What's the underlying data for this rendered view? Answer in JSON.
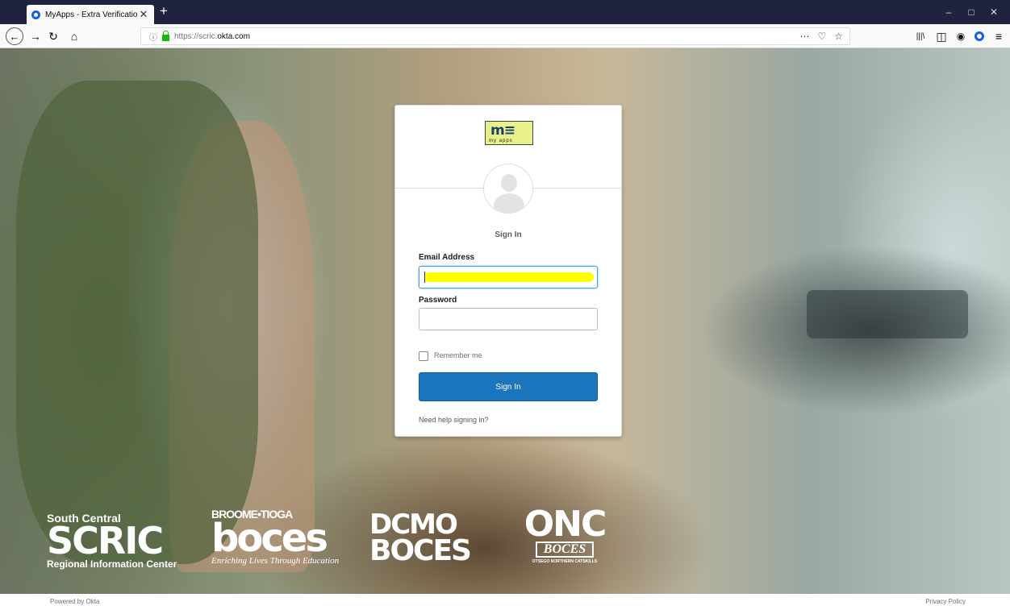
{
  "browser": {
    "tab_title": "MyApps - Extra Verification",
    "tab_close": "✕",
    "new_tab": "+",
    "url_prefix": "https://scric.",
    "url_domain": "okta.com",
    "info_icon": "ⓘ",
    "page_actions": "⋯",
    "pocket": "♡",
    "bookmark": "☆",
    "window_min": "–",
    "window_max": "□",
    "window_close": "✕",
    "library": "|||\\",
    "menu": "≡"
  },
  "login": {
    "logo_text": "m≡",
    "logo_sub": "my apps",
    "heading": "Sign In",
    "email_label": "Email Address",
    "email_value": "",
    "password_label": "Password",
    "remember_label": "Remember me",
    "remember_checked": false,
    "submit_label": "Sign In",
    "help_link": "Need help signing in?"
  },
  "logos": {
    "scric": {
      "line1": "South Central",
      "big": "SCRIC",
      "line2": "Regional Information Center"
    },
    "bt": {
      "line1": "BROOME•TIOGA",
      "big": "boces",
      "line2": "Enriching Lives Through Education"
    },
    "dcmo": {
      "line1": "DCMO",
      "line2": "BOCES"
    },
    "onc": {
      "big": "ONC",
      "boc": "BOCES",
      "line2": "OTSEGO NORTHERN CATSKILLS"
    }
  },
  "footer": {
    "powered": "Powered by Okta",
    "privacy": "Privacy Policy"
  },
  "colors": {
    "primary_button": "#1a75bc",
    "highlight": "#ffff00",
    "tabbar": "#202340"
  }
}
